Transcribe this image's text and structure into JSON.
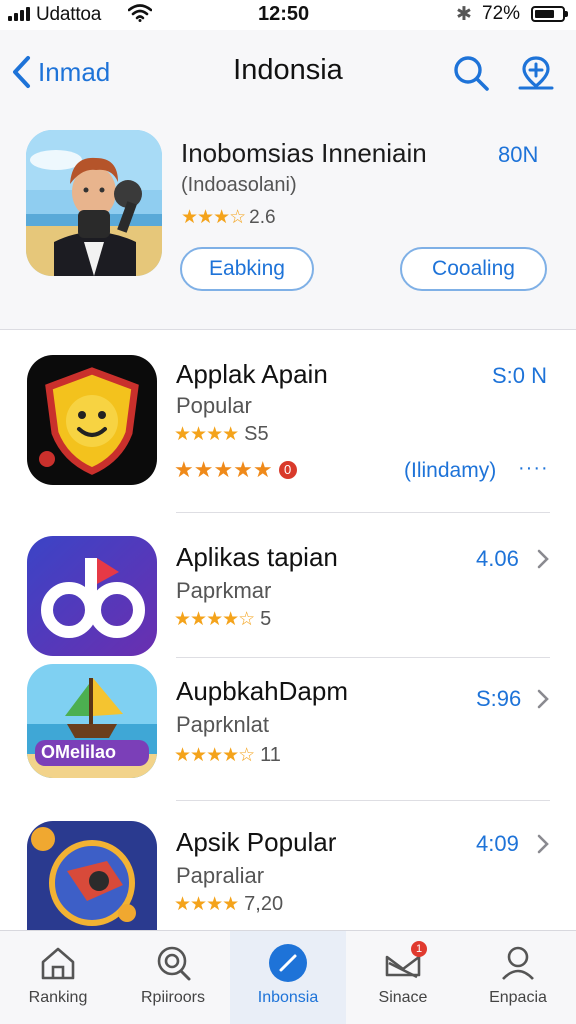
{
  "status_bar": {
    "carrier": "Udattoa",
    "time": "12:50",
    "battery": "72%",
    "battery_level": 0.72
  },
  "nav": {
    "back_label": "Inmad",
    "title": "Indonsia"
  },
  "featured": {
    "name": "Inobomsias Inneniain",
    "subtitle": "(Indoasolani)",
    "rating_text": "2.6",
    "rating_stars": 3.5,
    "price": "80N",
    "btn_left": "Eabking",
    "btn_right": "Cooaling"
  },
  "apps": [
    {
      "name": "Applak Apain",
      "category": "Popular",
      "rating_text": "S5",
      "price": "S:0 N",
      "extra_rating_badge": "0",
      "extra_link": "(Ilindamy)",
      "more_label": "····"
    },
    {
      "name": "Aplikas tapian",
      "category": "Paprkmar",
      "rating_text": "5",
      "price": "4.06"
    },
    {
      "name": "AupbkahDapm",
      "category": "Paprknlat",
      "rating_text": "11",
      "price": "S:96",
      "icon_label": "OMelilao"
    },
    {
      "name": "Apsik Popular",
      "category": "Papraliar",
      "rating_text": "7,20",
      "price": "4:09"
    }
  ],
  "tabs": [
    {
      "label": "Ranking",
      "icon": "home-icon"
    },
    {
      "label": "Rpiiroors",
      "icon": "search-icon"
    },
    {
      "label": "Inbonsia",
      "icon": "compass-icon"
    },
    {
      "label": "Sinace",
      "icon": "tray-icon",
      "badge": "1"
    },
    {
      "label": "Enpacia",
      "icon": "person-icon"
    }
  ],
  "colors": {
    "accent": "#1e73d8",
    "star": "#f4a31b",
    "bar_bg": "#f7f7f9"
  }
}
